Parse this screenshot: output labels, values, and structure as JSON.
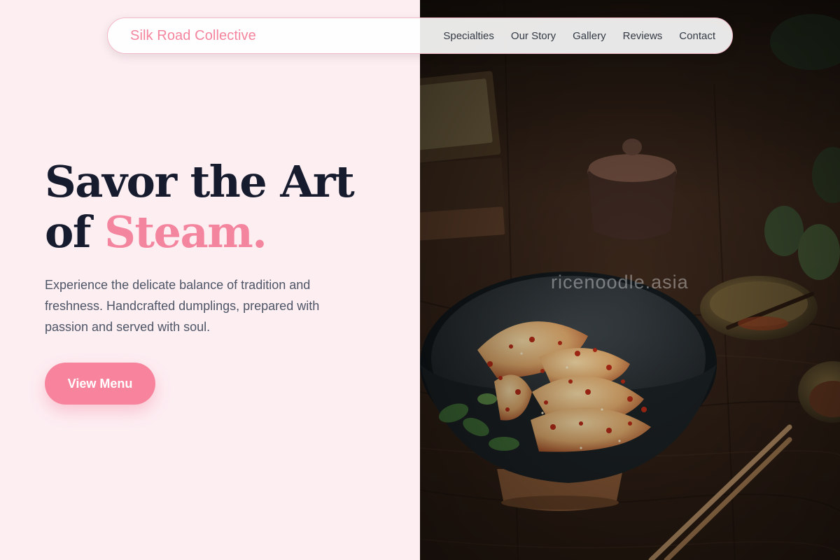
{
  "navbar": {
    "brand": "Silk Road Collective",
    "links": [
      "Specialties",
      "Our Story",
      "Gallery",
      "Reviews",
      "Contact"
    ]
  },
  "hero": {
    "title_line1": "Savor the Art",
    "title_line2_prefix": "of ",
    "title_accent": "Steam.",
    "description": "Experience the delicate balance of tradition and freshness. Handcrafted dumplings, prepared with passion and served with soul.",
    "cta_label": "View Menu"
  },
  "photo": {
    "watermark": "ricenoodle.asia",
    "subject": "dumplings in chili oil in dark bowl"
  },
  "colors": {
    "accent": "#f4859e",
    "background": "#fdeef2",
    "heading": "#161b2e",
    "body_text": "#4d5566"
  }
}
